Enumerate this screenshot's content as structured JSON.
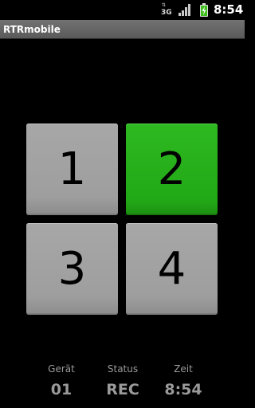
{
  "statusbar": {
    "network_label": "3G",
    "time": "8:54",
    "icons": [
      "data-arrows-icon",
      "signal-icon",
      "battery-charging-icon"
    ]
  },
  "app": {
    "title": "RTRmobile"
  },
  "buttons": [
    {
      "label": "1",
      "state": "inactive",
      "color": "#9e9e9e"
    },
    {
      "label": "2",
      "state": "active",
      "color": "#22a816"
    },
    {
      "label": "3",
      "state": "inactive",
      "color": "#9e9e9e"
    },
    {
      "label": "4",
      "state": "inactive",
      "color": "#9e9e9e"
    }
  ],
  "info": {
    "device": {
      "label": "Gerät",
      "value": "01"
    },
    "status": {
      "label": "Status",
      "value": "REC"
    },
    "time": {
      "label": "Zeit",
      "value": "8:54"
    }
  }
}
